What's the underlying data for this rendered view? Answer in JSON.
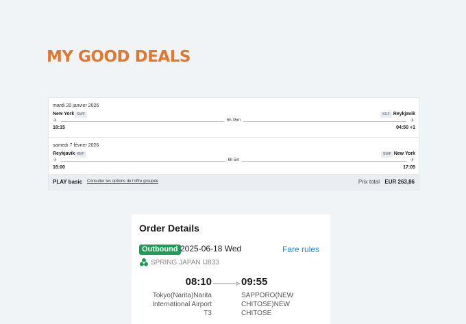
{
  "colors": {
    "accent": "#e07830",
    "badge": "#1a9d54",
    "link": "#1e88d6",
    "timeline": "#f2a8a8"
  },
  "page_title": "MY GOOD DEALS",
  "deal": {
    "legs": [
      {
        "date": "mardi 20 janvier 2026",
        "from_city": "New York",
        "from_code": "SWF",
        "to_code": "KEF",
        "to_city": "Reykjavik",
        "duration": "5h 35m",
        "dep_time": "18:15",
        "arr_time": "04:50 +1"
      },
      {
        "date": "samedi 7 février 2026",
        "from_city": "Reykjavik",
        "from_code": "KEF",
        "to_code": "SWF",
        "to_city": "New York",
        "duration": "6h 5m",
        "dep_time": "16:00",
        "arr_time": "17:05"
      }
    ],
    "fare_name": "PLAY basic",
    "fare_link": "Consulter les options de l'offre groupée",
    "total_label": "Prix total",
    "total_value": "EUR 263,86"
  },
  "order": {
    "title": "Order Details",
    "badge": "Outbound",
    "date": "2025-06-18 Wed",
    "fare_rules": "Fare rules",
    "airline_icon": "spring-logo-icon",
    "airline": "SPRING JAPAN IJ833",
    "dep_time": "08:10",
    "arr_time": "09:55",
    "dep_airport_lines": [
      "Tokyo(Narita)Narita",
      "International Airport",
      "T3"
    ],
    "arr_airport_lines": [
      "SAPPORO(NEW",
      "CHITOSE)NEW",
      "CHITOSE"
    ]
  }
}
